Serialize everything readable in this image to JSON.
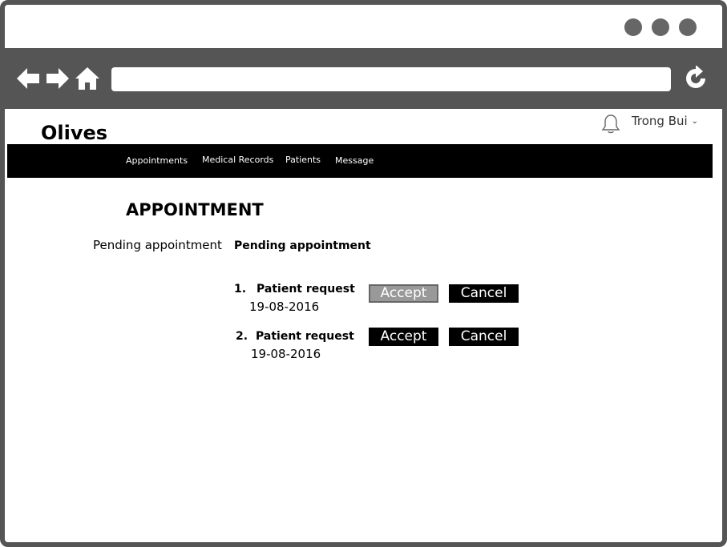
{
  "app": {
    "brand": "Olives"
  },
  "user": {
    "name": "Trong Bui",
    "chevron": "⌄"
  },
  "icons": {
    "back": "back-arrow-icon",
    "forward": "forward-arrow-icon",
    "home": "home-icon",
    "refresh": "refresh-icon",
    "bell": "bell-icon"
  },
  "colors": {
    "frame": "#555555",
    "menubar": "#000000",
    "accent_disabled": "#999999"
  },
  "nav": {
    "items": [
      {
        "label": "Appointments"
      },
      {
        "label": "Medical Records"
      },
      {
        "label": "Patients"
      },
      {
        "label": "Message"
      }
    ]
  },
  "main": {
    "title": "APPOINTMENT",
    "sidebar_link": "Pending appointment",
    "section_title": "Pending appointment",
    "requests": [
      {
        "number": "1.",
        "label": "Patient request",
        "date": "19-08-2016",
        "accept_label": "Accept",
        "cancel_label": "Cancel",
        "accept_state": "disabled"
      },
      {
        "number": "2.",
        "label": "Patient request",
        "date": "19-08-2016",
        "accept_label": "Accept",
        "cancel_label": "Cancel",
        "accept_state": "enabled"
      }
    ]
  }
}
